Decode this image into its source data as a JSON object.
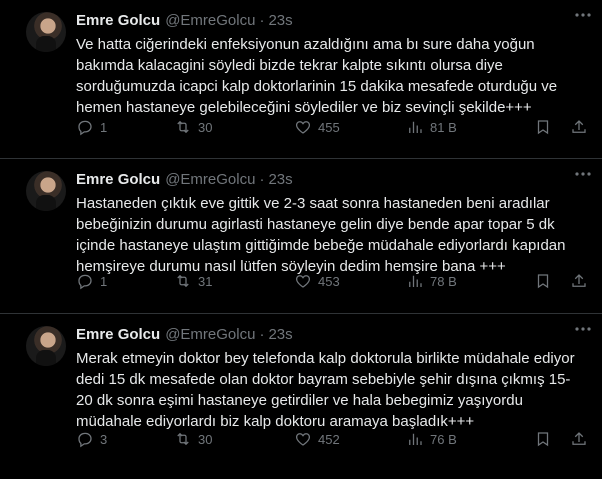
{
  "tweets": [
    {
      "name": "Emre Golcu",
      "handle": "@EmreGolcu",
      "dot": "·",
      "time": "23s",
      "text": "Ve hatta ciğerindeki enfeksiyonun azaldığını ama bı sure daha yoğun bakımda kalacagini söyledi bizde tekrar kalpte sıkıntı olursa diye sorduğumuzda icapci kalp doktorlarinin 15 dakika mesafede oturduğu ve hemen hastaneye gelebileceğini söylediler ve biz sevinçli şekilde+++",
      "replies": "1",
      "retweets": "30",
      "likes": "455",
      "views": "81 B"
    },
    {
      "name": "Emre Golcu",
      "handle": "@EmreGolcu",
      "dot": "·",
      "time": "23s",
      "text": "Hastaneden çıktık eve gittik ve 2-3 saat sonra hastaneden beni aradılar bebeğinizin durumu agirlasti hastaneye gelin diye bende apar topar 5 dk içinde hastaneye ulaştım gittiğimde bebeğe müdahale ediyorlardı kapıdan hemşireye durumu nasıl lütfen söyleyin dedim hemşire bana +++",
      "replies": "1",
      "retweets": "31",
      "likes": "453",
      "views": "78 B"
    },
    {
      "name": "Emre Golcu",
      "handle": "@EmreGolcu",
      "dot": "·",
      "time": "23s",
      "text": "Merak etmeyin doktor bey telefonda kalp doktorula birlikte müdahale ediyor dedi 15 dk mesafede olan doktor bayram sebebiyle şehir dışına çıkmış 15-20 dk sonra eşimi hastaneye getirdiler ve hala bebegimiz yaşıyordu müdahale ediyorlardı biz kalp doktoru aramaya başladık+++",
      "replies": "3",
      "retweets": "30",
      "likes": "452",
      "views": "76 B"
    }
  ],
  "icons": {
    "more": "more-icon",
    "reply": "reply-icon",
    "retweet": "retweet-icon",
    "like": "like-icon",
    "views": "views-icon",
    "bookmark": "bookmark-icon",
    "share": "share-icon"
  }
}
